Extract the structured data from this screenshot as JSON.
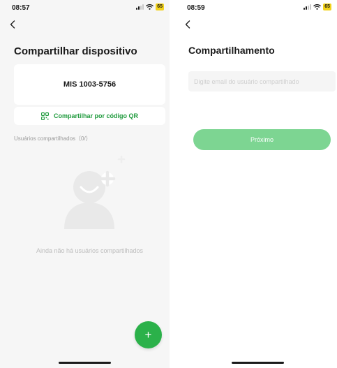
{
  "colors": {
    "accent_green": "#2bb14a",
    "link_green": "#1e9a3c",
    "disabled_green": "#7dd592",
    "battery_yellow": "#f2d21b",
    "left_background": "#f6f6f6"
  },
  "left_screen": {
    "status": {
      "time": "08:57",
      "battery": "65"
    },
    "back_icon": "chevron-left-icon",
    "title": "Compartilhar dispositivo",
    "device": {
      "name": "MIS 1003-5756"
    },
    "qr_share": {
      "icon": "qr-code-icon",
      "label": "Compartilhar por código QR"
    },
    "shared_users_label": "Usuários compartilhados（0/）",
    "empty_illustration_icon": "add-user-icon",
    "empty_text": "Ainda não há usuários compartilhados",
    "fab": {
      "icon": "plus-icon",
      "label": "+"
    }
  },
  "right_screen": {
    "status": {
      "time": "08:59",
      "battery": "65"
    },
    "back_icon": "chevron-left-icon",
    "title": "Compartilhamento",
    "email_input": {
      "placeholder": "Digite email do usuário compartilhado",
      "value": ""
    },
    "next_button": {
      "label": "Próximo"
    }
  }
}
